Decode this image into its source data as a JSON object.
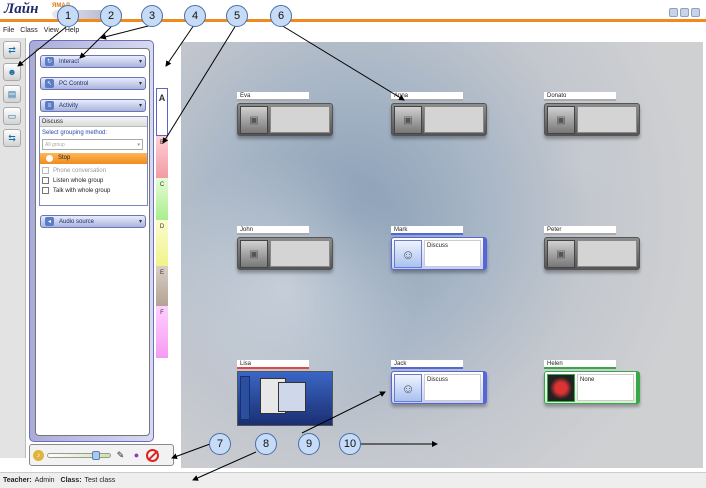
{
  "app": {
    "logo": "Лайн",
    "logo_sub": "ЯМАЛ"
  },
  "menu": [
    "File",
    "Class",
    "View",
    "Help"
  ],
  "panel": {
    "dropdowns": [
      {
        "label": "Interact"
      },
      {
        "label": "PC Control"
      },
      {
        "label": "Activity"
      }
    ],
    "discuss": {
      "title": "Discuss",
      "select_label": "Select grouping method:",
      "combo_value": "All group",
      "stop_label": "Stop",
      "options": [
        {
          "label": "Phone conversation",
          "disabled": true
        },
        {
          "label": "Listen whole group",
          "disabled": false
        },
        {
          "label": "Talk with whole group",
          "disabled": false
        }
      ]
    },
    "audio_source": "Audio source"
  },
  "group_letters": [
    "A",
    "B",
    "C",
    "D",
    "E",
    "F"
  ],
  "students": [
    {
      "name": "Eva",
      "status": ""
    },
    {
      "name": "Anna",
      "status": ""
    },
    {
      "name": "Donato",
      "status": ""
    },
    {
      "name": "John",
      "status": ""
    },
    {
      "name": "Mark",
      "status": "Discuss"
    },
    {
      "name": "Peter",
      "status": ""
    },
    {
      "name": "Lisa",
      "status": ""
    },
    {
      "name": "Jack",
      "status": "Discuss"
    },
    {
      "name": "Helen",
      "status": "None"
    }
  ],
  "volume": {
    "level": 0.82
  },
  "status": {
    "teacher_label": "Teacher:",
    "teacher": "Admin",
    "class_label": "Class:",
    "class": "Test class"
  },
  "callouts": [
    "1",
    "2",
    "3",
    "4",
    "5",
    "6",
    "7",
    "8",
    "9",
    "10"
  ]
}
